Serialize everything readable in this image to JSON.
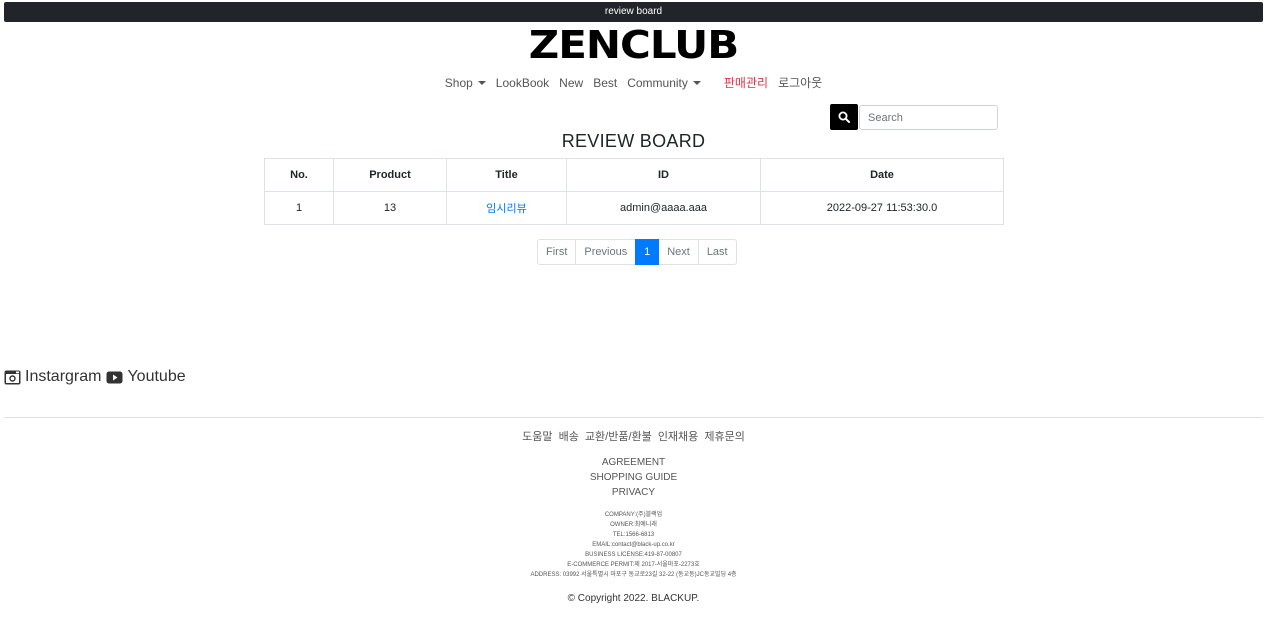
{
  "topbar": {
    "title": "review board"
  },
  "logo": {
    "text": "ZENCLUB"
  },
  "nav": {
    "shop": "Shop",
    "lookbook": "LookBook",
    "new": "New",
    "best": "Best",
    "community": "Community",
    "sales_admin": "판매관리",
    "logout": "로그아웃"
  },
  "search": {
    "placeholder": "Search"
  },
  "board": {
    "title": "REVIEW BOARD",
    "columns": [
      "No.",
      "Product",
      "Title",
      "ID",
      "Date"
    ],
    "rows": [
      {
        "no": "1",
        "product": "13",
        "title": "임시리뷰",
        "id": "admin@aaaa.aaa",
        "date": "2022-09-27 11:53:30.0"
      }
    ]
  },
  "pagination": {
    "first": "First",
    "previous": "Previous",
    "current": "1",
    "next": "Next",
    "last": "Last"
  },
  "social": {
    "instagram": "Instargram",
    "youtube": "Youtube"
  },
  "footer": {
    "links": [
      "도움말",
      "배송",
      "교환/반품/환불",
      "인재채용",
      "제휴문의"
    ],
    "policies": [
      "AGREEMENT",
      "SHOPPING GUIDE",
      "PRIVACY"
    ],
    "info": [
      "COMPANY:(주)블랙업",
      "OWNER:최예니래",
      "TEL:1566-6813",
      "EMAIL:contact@black-up.co.kr",
      "BUSINESS LICENSE:419-87-00807",
      "E-COMMERCE PERMIT:제 2017-서울마포-2273호",
      "ADDRESS: 03992 서울특별시 마포구 동교로23길 32-22 (동교동)JC동교빌딩 4층"
    ],
    "copyright": "© Copyright 2022. BLACKUP."
  },
  "colors": {
    "accent": "#007bff",
    "admin_link": "#dc3545",
    "topbar": "#212529"
  }
}
